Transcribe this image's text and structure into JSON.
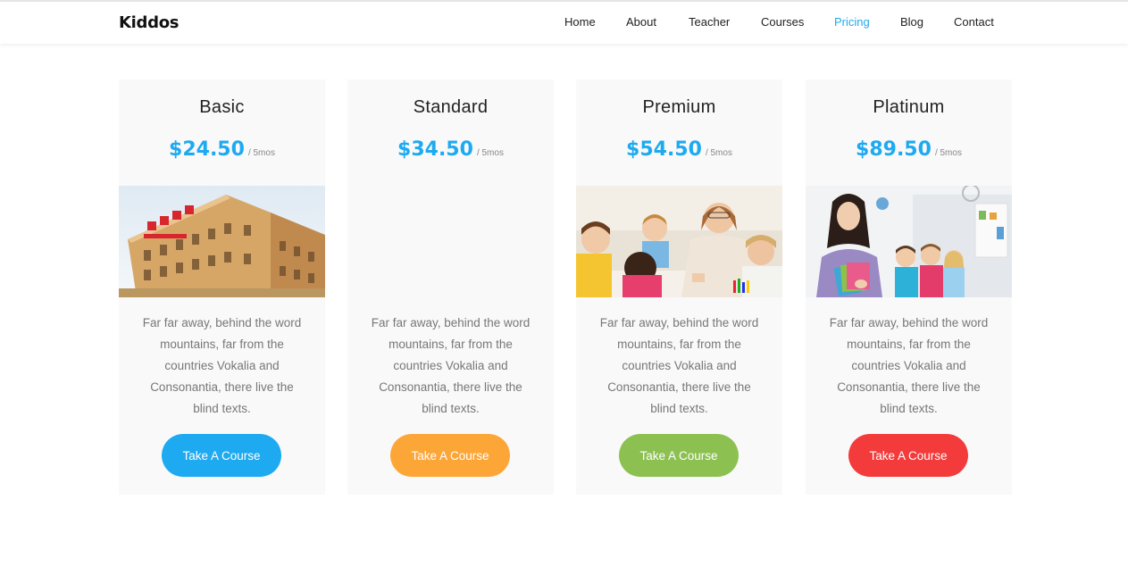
{
  "brand": "Kiddos",
  "nav": [
    {
      "label": "Home"
    },
    {
      "label": "About"
    },
    {
      "label": "Teacher"
    },
    {
      "label": "Courses"
    },
    {
      "label": "Pricing",
      "active": true
    },
    {
      "label": "Blog"
    },
    {
      "label": "Contact"
    }
  ],
  "accent_color": "#1eaaf1",
  "plans": [
    {
      "name": "Basic",
      "price": "$24.50",
      "period": "/ 5mos",
      "image": "school-building-photo",
      "description": "Far far away, behind the word mountains, far from the countries Vokalia and Consonantia, there live the blind texts.",
      "button_label": "Take A Course",
      "button_color": "#1eaaf1"
    },
    {
      "name": "Standard",
      "price": "$34.50",
      "period": "/ 5mos",
      "image": "",
      "description": "Far far away, behind the word mountains, far from the countries Vokalia and Consonantia, there live the blind texts.",
      "button_label": "Take A Course",
      "button_color": "#fda638"
    },
    {
      "name": "Premium",
      "price": "$54.50",
      "period": "/ 5mos",
      "image": "teacher-with-kids-photo",
      "description": "Far far away, behind the word mountains, far from the countries Vokalia and Consonantia, there live the blind texts.",
      "button_label": "Take A Course",
      "button_color": "#8cc152"
    },
    {
      "name": "Platinum",
      "price": "$89.50",
      "period": "/ 5mos",
      "image": "classroom-teacher-photo",
      "description": "Far far away, behind the word mountains, far from the countries Vokalia and Consonantia, there live the blind texts.",
      "button_label": "Take A Course",
      "button_color": "#f43b3b"
    }
  ]
}
